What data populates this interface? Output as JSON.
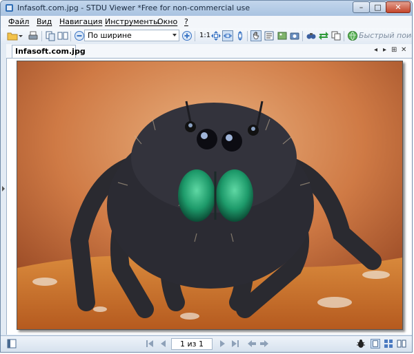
{
  "window": {
    "title": "Infasoft.com.jpg - STDU Viewer *Free for non-commercial use",
    "minimize_glyph": "–",
    "maximize_glyph": "□",
    "close_glyph": "✕"
  },
  "menu": {
    "items": [
      "Файл",
      "Вид",
      "Навигация",
      "Инструменты",
      "Окно",
      "?"
    ]
  },
  "toolbar": {
    "zoom_select_value": "По ширине",
    "actual_size_label": "1:1",
    "search_placeholder": "Быстрый поиск"
  },
  "tabs": {
    "active_tab_label": "Infasoft.com.jpg",
    "prev_glyph": "◂",
    "next_glyph": "▸",
    "grid_glyph": "⊞",
    "close_glyph": "✕"
  },
  "status": {
    "page_indicator": "1 из 1"
  },
  "colors": {
    "title_gradient_top": "#c3d6ec",
    "accent_blue": "#3a74c4",
    "close_red": "#c4452a"
  }
}
